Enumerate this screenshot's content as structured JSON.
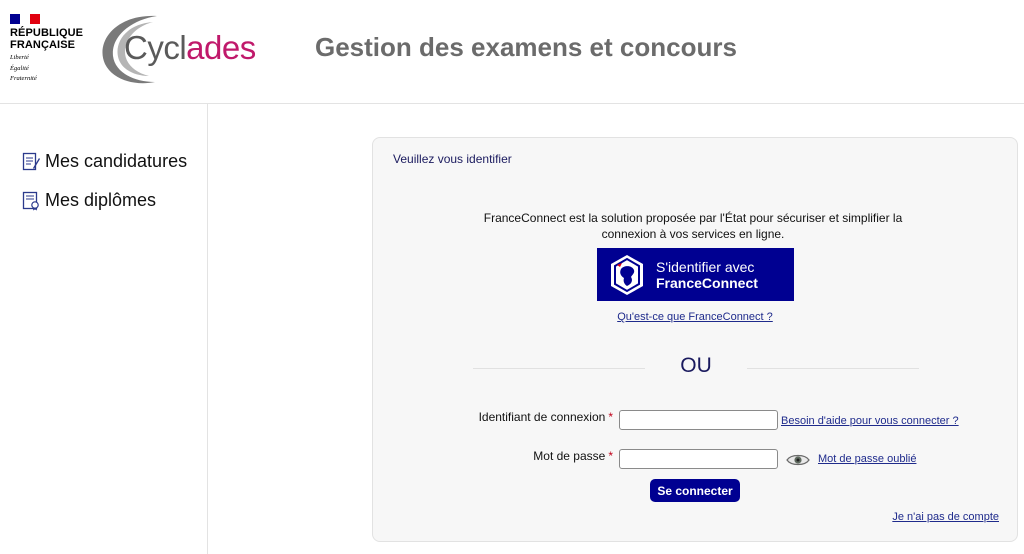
{
  "header": {
    "republic_name_line1": "RÉPUBLIQUE",
    "republic_name_line2": "FRANÇAISE",
    "motto_line1": "Liberté",
    "motto_line2": "Égalité",
    "motto_line3": "Fraternité",
    "logo_text_part1": "Cycl",
    "logo_text_part2": "ades",
    "app_title": "Gestion des examens et concours"
  },
  "sidebar": {
    "items": [
      {
        "label": "Mes candidatures",
        "icon": "document-edit-icon"
      },
      {
        "label": "Mes diplômes",
        "icon": "certificate-icon"
      }
    ]
  },
  "login": {
    "panel_title": "Veuillez vous identifier",
    "franceconnect_intro": "FranceConnect est la solution proposée par l'État pour sécuriser et simplifier la connexion à vos services en ligne.",
    "franceconnect_button_line1": "S'identifier avec",
    "franceconnect_button_line2": "FranceConnect",
    "franceconnect_info_link": "Qu'est-ce que FranceConnect ?",
    "separator_text": "OU",
    "username_label": "Identifiant de connexion",
    "username_value": "",
    "username_help_link": "Besoin d'aide pour vous connecter ?",
    "password_label": "Mot de passe",
    "password_value": "",
    "password_forgot_link": "Mot de passe oublié",
    "required_marker": "*",
    "submit_label": "Se connecter",
    "no_account_link": "Je n'ai pas de compte"
  },
  "colors": {
    "brand_blue": "#000091",
    "link_blue": "#1f2b8c",
    "logo_pink": "#c0196b",
    "required_red": "#c0001a"
  }
}
